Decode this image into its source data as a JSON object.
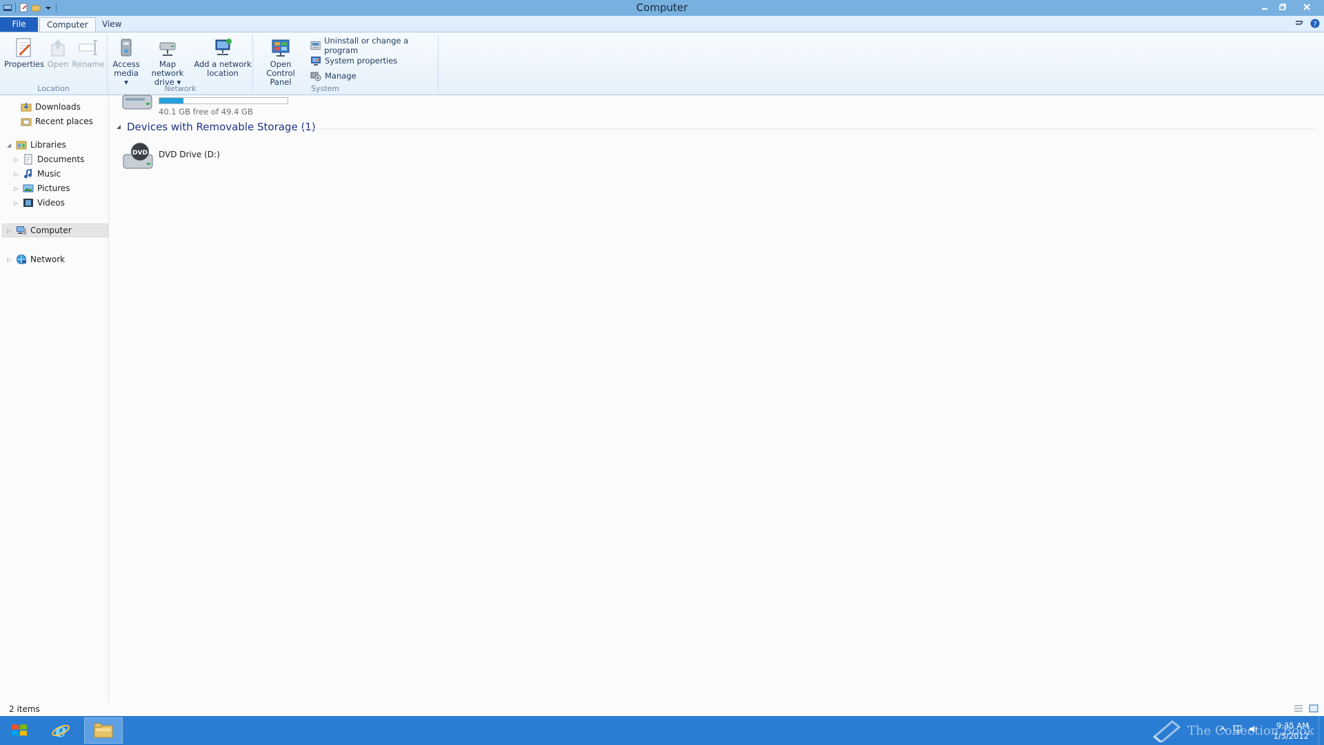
{
  "window": {
    "title": "Computer"
  },
  "ribbon": {
    "tabs": [
      {
        "label": "File"
      },
      {
        "label": "Computer"
      },
      {
        "label": "View"
      }
    ],
    "groups": {
      "location": {
        "label": "Location",
        "properties": "Properties",
        "open": "Open",
        "rename": "Rename"
      },
      "network": {
        "label": "Network",
        "access_media_1": "Access",
        "access_media_2": "media ▾",
        "map_drive_1": "Map network",
        "map_drive_2": "drive ▾",
        "add_location_1": "Add a network",
        "add_location_2": "location"
      },
      "system": {
        "label": "System",
        "control_panel_1": "Open Control",
        "control_panel_2": "Panel",
        "uninstall": "Uninstall or change a program",
        "system_properties": "System properties",
        "manage": "Manage"
      }
    }
  },
  "nav": {
    "downloads": "Downloads",
    "recent": "Recent places",
    "libraries": "Libraries",
    "documents": "Documents",
    "music": "Music",
    "pictures": "Pictures",
    "videos": "Videos",
    "computer": "Computer",
    "network": "Network"
  },
  "content": {
    "hard_drive": {
      "free_text": "40.1 GB free of 49.4 GB",
      "used_fraction": 0.19
    },
    "removable_group": "Devices with Removable Storage (1)",
    "dvd_drive": "DVD Drive (D:)",
    "dvd_badge": "DVD"
  },
  "status": {
    "count": "2 items"
  },
  "taskbar": {
    "time": "9:35 AM",
    "date": "1/5/2012",
    "watermark": "The Collection Book"
  },
  "colors": {
    "accent": "#1f5fbd",
    "titlebar": "#78b0e0",
    "taskbar": "#2b7dd3",
    "capacity": "#26a0da"
  }
}
